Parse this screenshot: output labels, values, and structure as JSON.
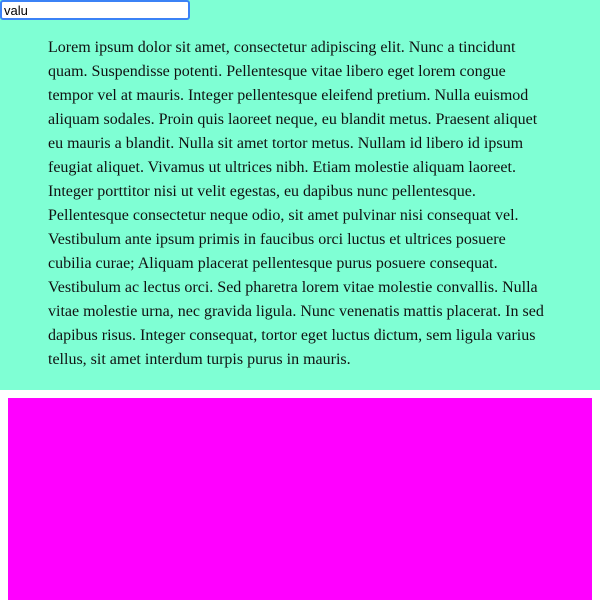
{
  "input": {
    "value": "valu",
    "placeholder": ""
  },
  "content": {
    "paragraph": "Lorem ipsum dolor sit amet, consectetur adipiscing elit. Nunc a tincidunt quam. Suspendisse potenti. Pellentesque vitae libero eget lorem congue tempor vel at mauris. Integer pellentesque eleifend pretium. Nulla euismod aliquam sodales. Proin quis laoreet neque, eu blandit metus. Praesent aliquet eu mauris a blandit. Nulla sit amet tortor metus. Nullam id libero id ipsum feugiat aliquet. Vivamus ut ultrices nibh. Etiam molestie aliquam laoreet. Integer porttitor nisi ut velit egestas, eu dapibus nunc pellentesque. Pellentesque consectetur neque odio, sit amet pulvinar nisi consequat vel. Vestibulum ante ipsum primis in faucibus orci luctus et ultrices posuere cubilia curae; Aliquam placerat pellentesque purus posuere consequat. Vestibulum ac lectus orci. Sed pharetra lorem vitae molestie convallis. Nulla vitae molestie urna, nec gravida ligula. Nunc venenatis mattis placerat. In sed dapibus risus. Integer consequat, tortor eget luctus dictum, sem ligula varius tellus, sit amet interdum turpis purus in mauris."
  },
  "colors": {
    "panel_background": "#7fffd4",
    "box_background": "#ff00ff",
    "input_border": "#3b82f6"
  }
}
